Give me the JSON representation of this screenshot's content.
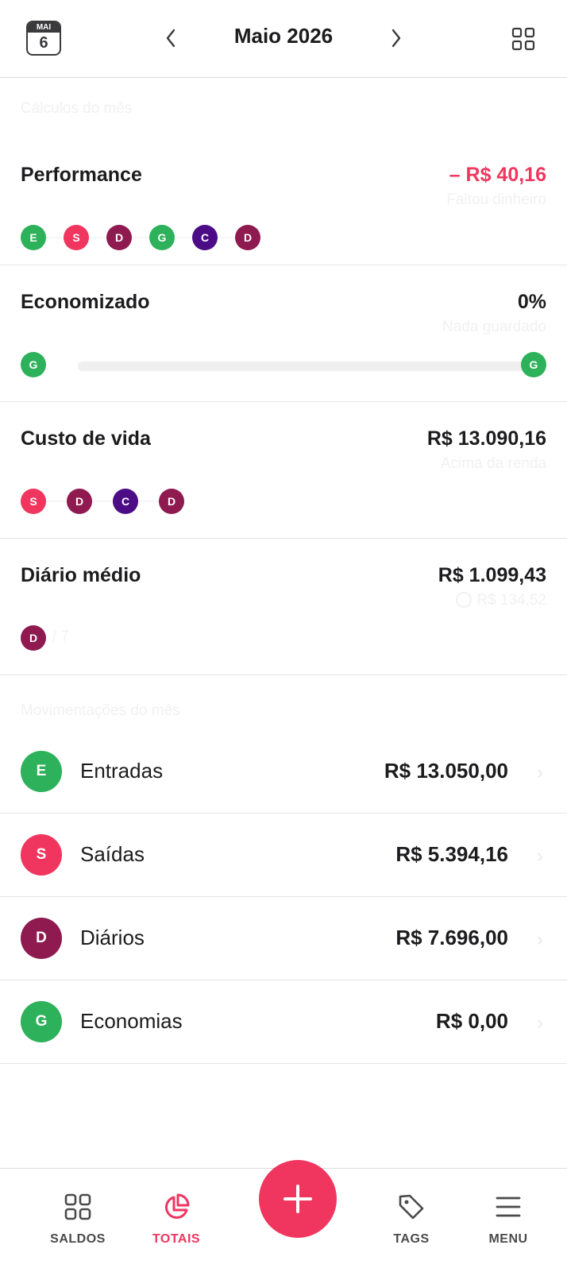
{
  "header": {
    "calendar": {
      "month": "MAI",
      "day": "6"
    },
    "title": "Maio 2026",
    "prev_icon": "chevron-left-icon",
    "next_icon": "chevron-right-icon",
    "grid_icon": "grid-icon"
  },
  "sections": {
    "calc_label": "Cálculos do mês",
    "mov_label": "Movimentações do mês"
  },
  "performance": {
    "name": "Performance",
    "value": "– R$ 40,16",
    "value_color": "#f0365f",
    "sub": "Faltou dinheiro",
    "dots": [
      "E",
      "S",
      "D",
      "G",
      "C",
      "D"
    ]
  },
  "economizado": {
    "name": "Economizado",
    "value": "0%",
    "sub": "Nada guardado",
    "progress": 0,
    "start_dot": "G",
    "end_dot": "G"
  },
  "custo": {
    "name": "Custo de vida",
    "value": "R$ 13.090,16",
    "sub": "Acima da renda",
    "dots": [
      "S",
      "D",
      "C",
      "D"
    ]
  },
  "diario": {
    "name": "Diário médio",
    "value": "R$ 1.099,43",
    "sub": "R$ 134,52",
    "dot": "D",
    "divisor": "/ 7"
  },
  "movimentacoes": [
    {
      "letter": "E",
      "label": "Entradas",
      "amount": "R$ 13.050,00"
    },
    {
      "letter": "S",
      "label": "Saídas",
      "amount": "R$ 5.394,16"
    },
    {
      "letter": "D",
      "label": "Diários",
      "amount": "R$ 7.696,00"
    },
    {
      "letter": "G",
      "label": "Economias",
      "amount": "R$ 0,00"
    }
  ],
  "colors": {
    "E": "#2db15a",
    "S": "#f0365f",
    "D": "#8e1a4f",
    "G": "#2db15a",
    "C": "#4b0c86",
    "accent": "#f0365f"
  },
  "tabs": [
    {
      "label": "SALDOS",
      "icon": "grid-icon",
      "active": false
    },
    {
      "label": "TOTAIS",
      "icon": "pie-chart-icon",
      "active": true
    },
    {
      "label": "TAGS",
      "icon": "tag-icon",
      "active": false
    },
    {
      "label": "MENU",
      "icon": "menu-icon",
      "active": false
    }
  ],
  "fab": {
    "icon": "plus-icon"
  }
}
